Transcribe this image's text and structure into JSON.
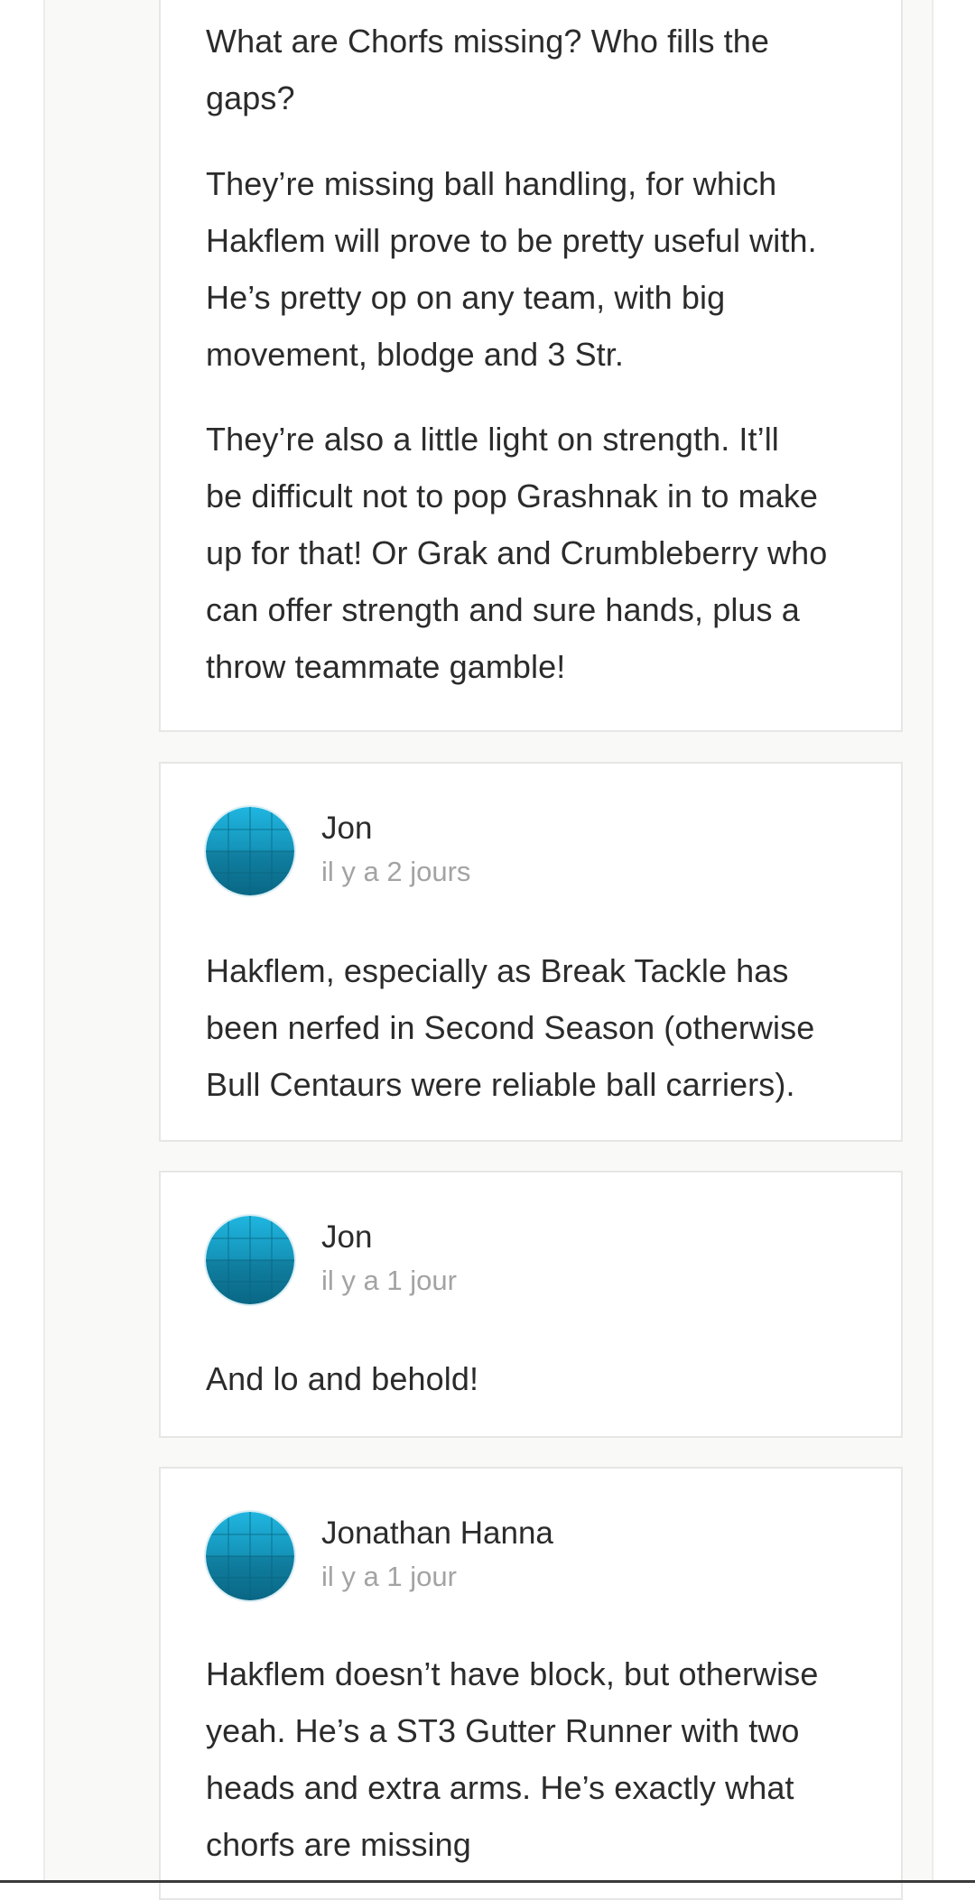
{
  "comments": [
    {
      "paragraphs": [
        [
          "What are Chorfs missing? Who fills the",
          "gaps?"
        ],
        [
          "They’re missing ball handling, for which",
          "Hakflem will prove to be pretty useful with.",
          "He’s pretty op on any team, with big",
          "movement, blodge and 3 Str."
        ],
        [
          "They’re also a little light on strength. It’ll",
          "be difficult not to pop Grashnak in to make",
          "up for that! Or Grak and Crumbleberry who",
          "can offer strength and sure hands, plus a",
          "throw teammate gamble!"
        ]
      ]
    },
    {
      "author": "Jon",
      "time": "il y a 2 jours",
      "avatar_icon": "globe-avatar-icon",
      "paragraphs": [
        [
          "Hakflem, especially as Break Tackle has",
          "been nerfed in Second Season (otherwise",
          "Bull Centaurs were reliable ball carriers)."
        ]
      ]
    },
    {
      "author": "Jon",
      "time": "il y a 1 jour",
      "avatar_icon": "globe-avatar-icon",
      "paragraphs": [
        [
          "And lo and behold!"
        ]
      ]
    },
    {
      "author": "Jonathan Hanna",
      "time": "il y a 1 jour",
      "avatar_icon": "globe-avatar-icon",
      "paragraphs": [
        [
          "Hakflem doesn’t have block, but otherwise",
          "yeah. He’s a ST3 Gutter Runner with two",
          "heads and extra arms. He’s exactly what",
          "chorfs are missing"
        ]
      ]
    }
  ],
  "colors": {
    "text": "#2b2b2b",
    "muted": "#a3a3a3",
    "avatar_light": "#1fb6e0",
    "avatar_dark": "#0a6f8f"
  }
}
